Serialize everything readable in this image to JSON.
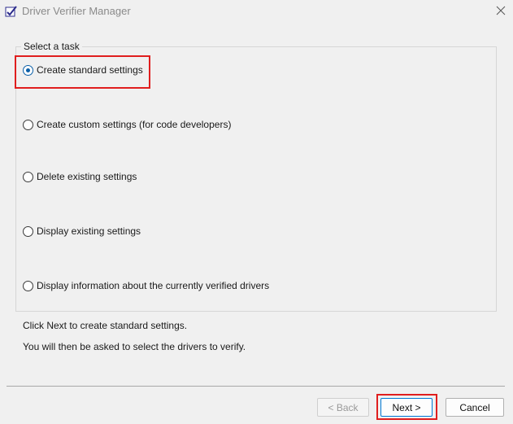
{
  "window": {
    "title": "Driver Verifier Manager"
  },
  "group": {
    "label": "Select a task"
  },
  "options": [
    {
      "label": "Create standard settings",
      "checked": true
    },
    {
      "label": "Create custom settings (for code developers)",
      "checked": false
    },
    {
      "label": "Delete existing settings",
      "checked": false
    },
    {
      "label": "Display existing settings",
      "checked": false
    },
    {
      "label": "Display information about the currently verified drivers",
      "checked": false
    }
  ],
  "description": {
    "line1": "Click Next to create standard settings.",
    "line2": "You will then be asked to select the drivers to verify."
  },
  "buttons": {
    "back": "< Back",
    "next": "Next >",
    "cancel": "Cancel"
  },
  "colors": {
    "highlight": "#e01e1e",
    "accent": "#0a5fa8"
  }
}
